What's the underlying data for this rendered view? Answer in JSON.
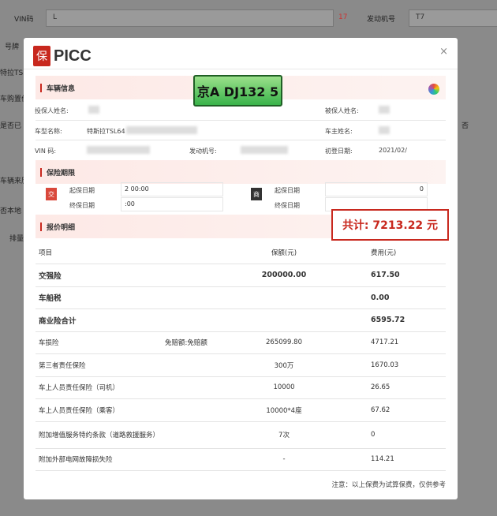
{
  "background": {
    "vin_label": "VIN码",
    "vin_value": "L",
    "vin_count": "17",
    "engine_label": "发动机号",
    "engine_value": "T7",
    "side_labels": [
      "号牌",
      "特拉TSL",
      "车购置价",
      "是否已",
      "车辆来历",
      "否本地",
      "排量"
    ],
    "right_value": "否"
  },
  "modal": {
    "logo_text": "PICC",
    "logo_mark": "保",
    "close": "×",
    "plate": "京A DJ132 5",
    "sections": {
      "vehicle": "车辆信息",
      "period": "保险期限",
      "quote": "报价明细"
    },
    "vehicle": {
      "applicant_label": "投保人姓名:",
      "insured_label": "被保人姓名:",
      "model_label": "车型名称:",
      "model_value": "特斯拉TSL64",
      "owner_label": "车主姓名:",
      "vin_label": "VIN 码:",
      "engine_label": "发动机号:",
      "reg_label": "初登日期:",
      "reg_value": "2021/02/"
    },
    "period": {
      "jiao_tag": "交",
      "shang_tag": "商",
      "start_label": "起保日期",
      "end_label": "终保日期",
      "jiao_start": "2 00:00",
      "jiao_end": ":00",
      "shang_start": "0"
    },
    "total": "共计: 7213.22 元",
    "table": {
      "headers": [
        "项目",
        "",
        "保额(元)",
        "费用(元)"
      ],
      "rows": [
        {
          "item": "交强险",
          "note": "",
          "amount": "200000.00",
          "fee": "617.50",
          "bold": true
        },
        {
          "item": "车船税",
          "note": "",
          "amount": "",
          "fee": "0.00",
          "bold": true
        },
        {
          "item": "商业险合计",
          "note": "",
          "amount": "",
          "fee": "6595.72",
          "bold": true
        },
        {
          "item": "车损险",
          "note": "免赔额:免赔额",
          "amount": "265099.80",
          "fee": "4717.21"
        },
        {
          "item": "第三者责任保险",
          "note": "",
          "amount": "300万",
          "fee": "1670.03"
        },
        {
          "item": "车上人员责任保险（司机）",
          "note": "",
          "amount": "10000",
          "fee": "26.65"
        },
        {
          "item": "车上人员责任保险（乘客）",
          "note": "",
          "amount": "10000*4座",
          "fee": "67.62"
        },
        {
          "item": "附加增值服务特约条款（道路救援服务）",
          "note": "",
          "amount": "7次",
          "fee": "0"
        },
        {
          "item": "附加外部电网故障损失险",
          "note": "",
          "amount": "-",
          "fee": "114.21"
        }
      ]
    },
    "note": "注意：以上保费为试算保费，仅供参考"
  }
}
